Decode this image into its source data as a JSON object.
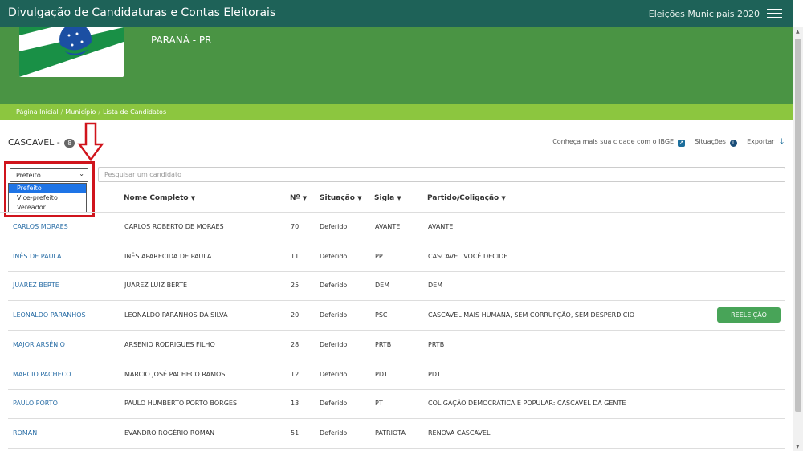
{
  "topbar": {
    "title": "Divulgação de Candidaturas e Contas Eleitorais",
    "election": "Eleições Municipais 2020"
  },
  "hero": {
    "state": "PARANÁ - PR"
  },
  "breadcrumb": {
    "items": [
      "Página Inicial",
      "Município",
      "Lista de Candidatos"
    ]
  },
  "city": {
    "name": "CASCAVEL - ",
    "count": "8"
  },
  "actions": {
    "ibge": "Conheça mais sua cidade com o IBGE",
    "situacoes": "Situações",
    "exportar": "Exportar"
  },
  "filter": {
    "selected": "Prefeito",
    "options": [
      "Prefeito",
      "Vice-prefeito",
      "Vereador"
    ]
  },
  "search": {
    "placeholder": "Pesquisar um candidato"
  },
  "table": {
    "headers": [
      "Nome Completo",
      "Nº",
      "Situação",
      "Sigla",
      "Partido/Coligação"
    ],
    "rows": [
      {
        "urna": "CARLOS MORAES",
        "nome": "CARLOS ROBERTO DE MORAES",
        "numero": "70",
        "situacao": "Deferido",
        "sigla": "AVANTE",
        "partido": "AVANTE",
        "badge": ""
      },
      {
        "urna": "INÊS DE PAULA",
        "nome": "INÊS APARECIDA DE PAULA",
        "numero": "11",
        "situacao": "Deferido",
        "sigla": "PP",
        "partido": "CASCAVEL VOCÊ DECIDE",
        "badge": ""
      },
      {
        "urna": "JUAREZ BERTE",
        "nome": "JUAREZ LUIZ BERTE",
        "numero": "25",
        "situacao": "Deferido",
        "sigla": "DEM",
        "partido": "DEM",
        "badge": ""
      },
      {
        "urna": "LEONALDO PARANHOS",
        "nome": "LEONALDO PARANHOS DA SILVA",
        "numero": "20",
        "situacao": "Deferido",
        "sigla": "PSC",
        "partido": "CASCAVEL MAIS HUMANA, SEM CORRUPÇÃO, SEM DESPERDICIO",
        "badge": "REELEIÇÃO"
      },
      {
        "urna": "MAJOR ARSÊNIO",
        "nome": "ARSENIO RODRIGUES FILHO",
        "numero": "28",
        "situacao": "Deferido",
        "sigla": "PRTB",
        "partido": "PRTB",
        "badge": ""
      },
      {
        "urna": "MARCIO PACHECO",
        "nome": "MARCIO JOSÉ PACHECO RAMOS",
        "numero": "12",
        "situacao": "Deferido",
        "sigla": "PDT",
        "partido": "PDT",
        "badge": ""
      },
      {
        "urna": "PAULO PORTO",
        "nome": "PAULO HUMBERTO PORTO BORGES",
        "numero": "13",
        "situacao": "Deferido",
        "sigla": "PT",
        "partido": "COLIGAÇÃO DEMOCRÁTICA E POPULAR: CASCAVEL DA GENTE",
        "badge": ""
      },
      {
        "urna": "ROMAN",
        "nome": "EVANDRO ROGÉRIO ROMAN",
        "numero": "51",
        "situacao": "Deferido",
        "sigla": "PATRIOTA",
        "partido": "RENOVA CASCAVEL",
        "badge": ""
      }
    ]
  },
  "colors": {
    "topbar": "#1e6258",
    "hero": "#4a9444",
    "breadcrumb": "#8cc63f",
    "link": "#2a6ea6",
    "highlight": "#d0141c",
    "badge": "#48a458"
  }
}
